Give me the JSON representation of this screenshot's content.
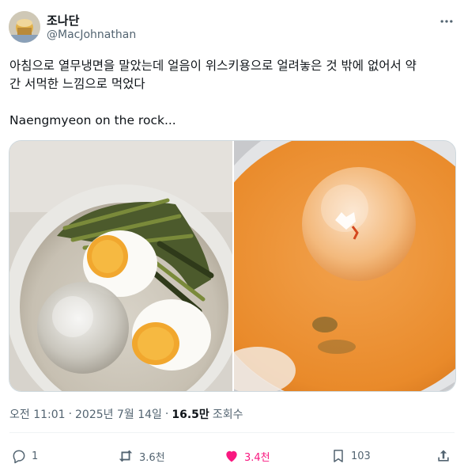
{
  "author": {
    "name": "조나단",
    "handle": "@MacJohnathan"
  },
  "tweet": {
    "text": "아침으로 열무냉면을 말았는데 얼음이 위스키용으로 얼려놓은 것 밖에 없어서 약\n간 서먹한 느낌으로 먹었다\n\nNaengmyeon on the rock..."
  },
  "meta": {
    "time": "오전 11:01",
    "separator": "·",
    "date": "2025년 7월 14일",
    "separator2": "·",
    "views_count": "16.5만",
    "views_label": "조회수"
  },
  "actions": {
    "reply_count": "1",
    "retweet_count": "3.6천",
    "like_count": "3.4천",
    "bookmark_count": "103"
  },
  "colors": {
    "text": "#0f1419",
    "secondary": "#536471",
    "like": "#f91880",
    "divider": "#eff3f4"
  },
  "icons": [
    "more-icon",
    "reply-icon",
    "retweet-icon",
    "heart-icon",
    "bookmark-icon",
    "share-icon"
  ]
}
